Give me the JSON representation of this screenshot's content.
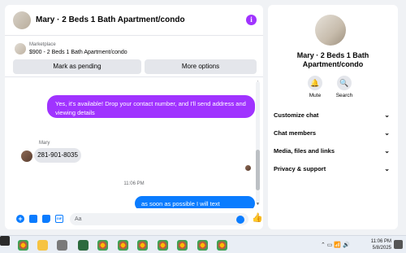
{
  "chat": {
    "title": "Mary · 2 Beds 1 Bath Apartment/condo",
    "info_icon": "i",
    "marketplace_label": "Marketplace",
    "marketplace_desc": "$900 - 2 Beds 1 Bath Apartment/condo",
    "mark_pending_label": "Mark as pending",
    "more_options_label": "More options"
  },
  "messages": {
    "outgoing_1": "Yes, it's available! Drop your contact number, and I'll send address and viewing details",
    "sender_name": "Mary",
    "incoming_1": "281-901-8035",
    "timestamp": "11:06 PM",
    "outgoing_2": "as soon as possible I will text you..Thanks"
  },
  "composer": {
    "placeholder": "Aa",
    "gif_label": "GIF"
  },
  "info_panel": {
    "title": "Mary · 2 Beds 1 Bath Apartment/condo",
    "mute_label": "Mute",
    "search_label": "Search",
    "sections": [
      "Customize chat",
      "Chat members",
      "Media, files and links",
      "Privacy & support"
    ]
  },
  "taskbar": {
    "time": "11:06 PM",
    "date": "5/8/2025"
  },
  "colors": {
    "accent_purple": "#a033ff",
    "accent_blue": "#0a7cff"
  },
  "icons": [
    "info-icon",
    "plus-icon",
    "photo-icon",
    "sticker-icon",
    "gif-icon",
    "emoji-icon",
    "like-icon",
    "bell-icon",
    "search-icon",
    "chevron-down-icon"
  ]
}
